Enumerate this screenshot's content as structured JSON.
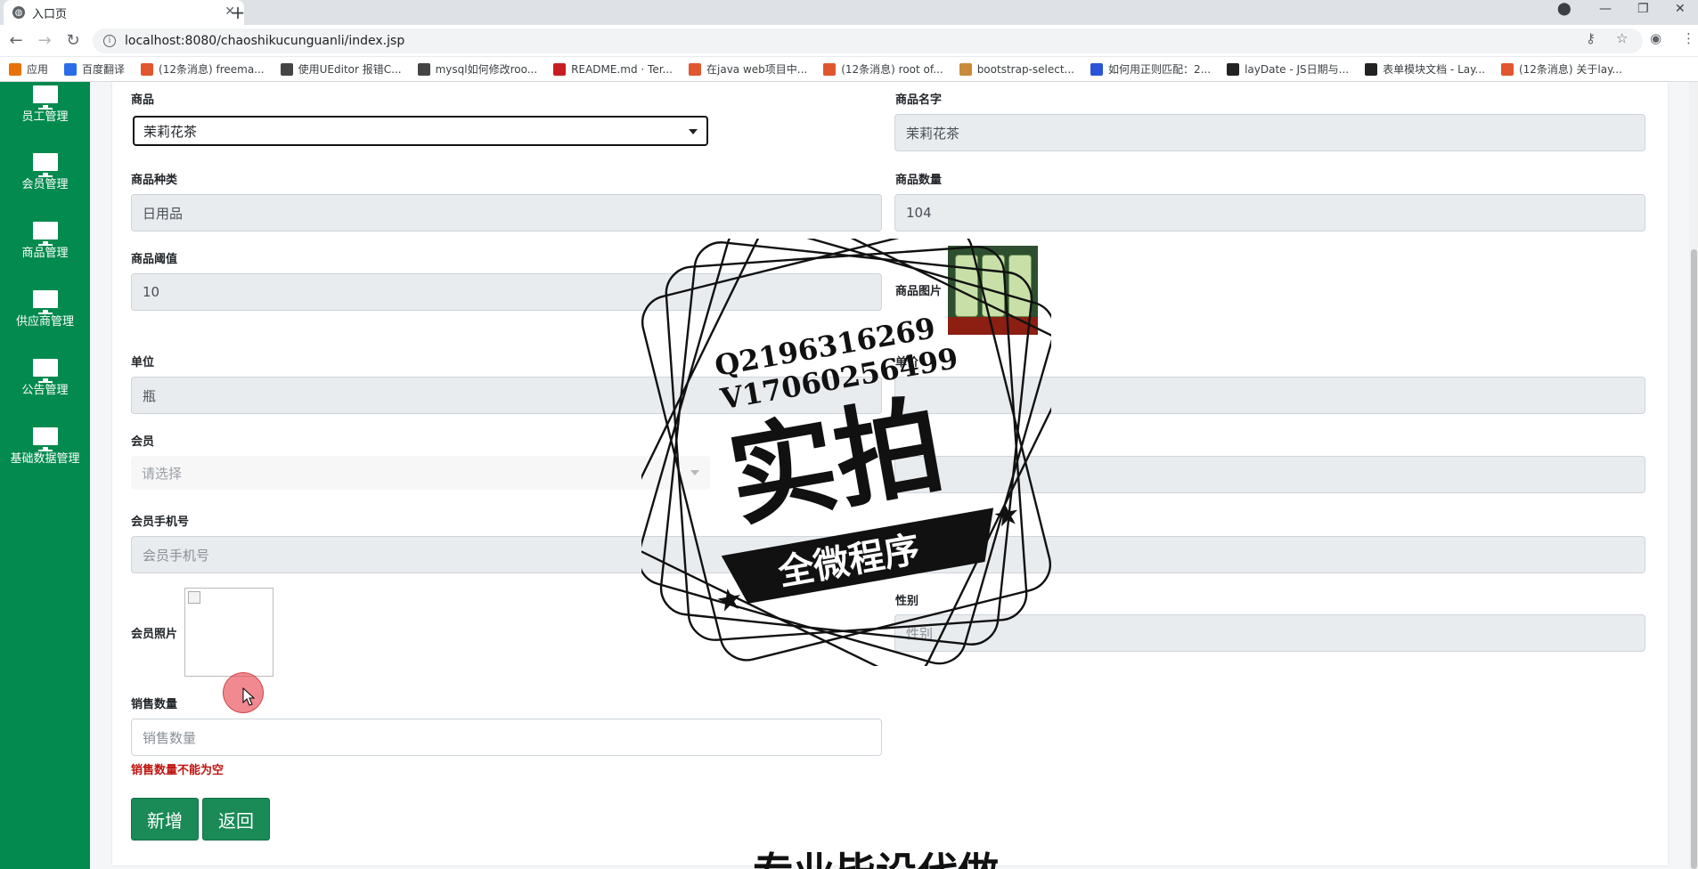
{
  "browser": {
    "tab_title": "入口页",
    "url": "localhost:8080/chaoshikucunguanli/index.jsp",
    "bookmarks": [
      {
        "label": "应用",
        "color": "#e8710a"
      },
      {
        "label": "百度翻译",
        "color": "#2b6de8"
      },
      {
        "label": "(12条消息) freema...",
        "color": "#e0562f"
      },
      {
        "label": "使用UEditor 报错C...",
        "color": "#444444"
      },
      {
        "label": "mysql如何修改roo...",
        "color": "#444444"
      },
      {
        "label": "README.md · Ter...",
        "color": "#c71d23"
      },
      {
        "label": "在java web项目中...",
        "color": "#e0562f"
      },
      {
        "label": "(12条消息) root of...",
        "color": "#e0562f"
      },
      {
        "label": "bootstrap-select...",
        "color": "#c98a3a"
      },
      {
        "label": "如何用正则匹配：2...",
        "color": "#2b54d6"
      },
      {
        "label": "layDate - JS日期与...",
        "color": "#222222"
      },
      {
        "label": "表单模块文档 - Lay...",
        "color": "#222222"
      },
      {
        "label": "(12条消息) 关于lay...",
        "color": "#e0562f"
      }
    ]
  },
  "sidebar": {
    "items": [
      {
        "label": "员工管理"
      },
      {
        "label": "会员管理"
      },
      {
        "label": "商品管理"
      },
      {
        "label": "供应商管理"
      },
      {
        "label": "公告管理"
      },
      {
        "label": "基础数据管理"
      }
    ]
  },
  "form": {
    "product_label": "商品",
    "product_selected": "茉莉花茶",
    "product_name_label": "商品名字",
    "product_name_value": "茉莉花茶",
    "category_label": "商品种类",
    "category_value": "日用品",
    "quantity_label": "商品数量",
    "quantity_value": "104",
    "threshold_label": "商品阈值",
    "threshold_value": "10",
    "image_label": "商品图片",
    "unit_label": "单位",
    "unit_value": "瓶",
    "price_label": "单价",
    "member_label": "会员",
    "member_placeholder": "请选择",
    "member_phone_label": "会员手机号",
    "member_phone_placeholder": "会员手机号",
    "member_photo_label": "会员照片",
    "gender_label": "性别",
    "gender_placeholder": "性别",
    "sale_qty_label": "销售数量",
    "sale_qty_placeholder": "销售数量",
    "sale_qty_error": "销售数量不能为空",
    "add_button": "新增",
    "back_button": "返回"
  },
  "watermark": {
    "line1": "Q2196316269",
    "line2": "V17060256499",
    "main": "实拍",
    "ribbon": "全微程序",
    "bottom": "专业毕设代做"
  },
  "colors": {
    "sidebar": "#038a4e",
    "button": "#1a8a56",
    "error": "#c0140f"
  }
}
